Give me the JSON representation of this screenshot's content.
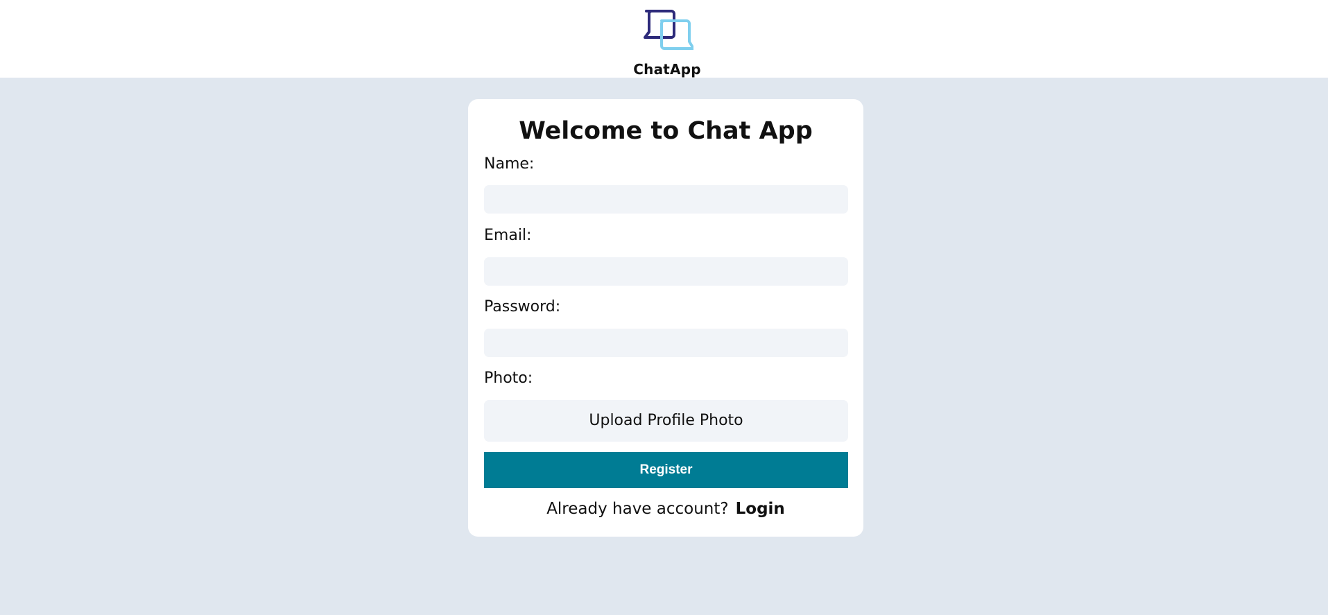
{
  "header": {
    "logo_text": "ChatApp",
    "logo_icon": "chat-bubbles-icon",
    "icon_colors": {
      "back": "#2d2a7a",
      "front": "#7fcfee"
    }
  },
  "form": {
    "title": "Welcome to Chat App",
    "fields": [
      {
        "label": "Name:",
        "value": "",
        "placeholder": ""
      },
      {
        "label": "Email:",
        "value": "",
        "placeholder": ""
      },
      {
        "label": "Password:",
        "value": "",
        "placeholder": ""
      }
    ],
    "photo_label": "Photo:",
    "upload_label": "Upload Profile Photo",
    "submit_label": "Register",
    "submit_color": "#007c94",
    "footer_text": "Already have account?",
    "login_label": "Login"
  }
}
